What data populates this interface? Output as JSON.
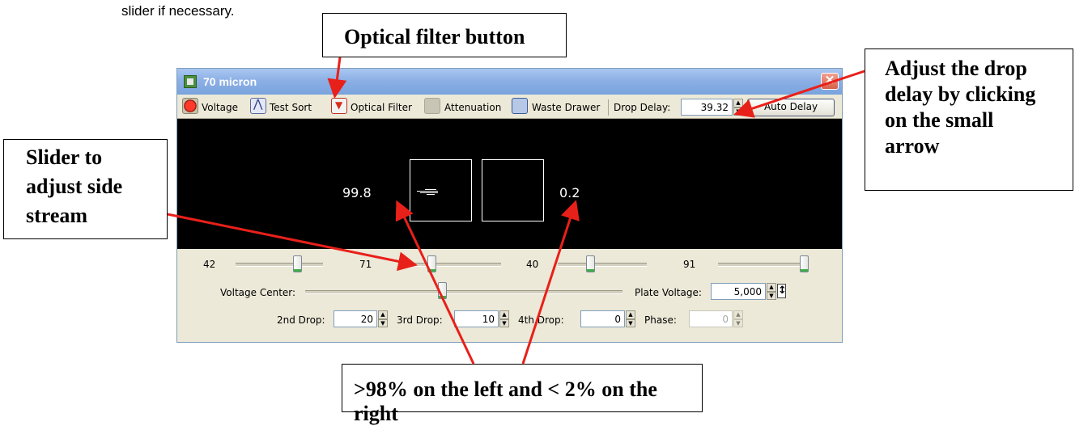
{
  "doc_text": "slider if necessary.",
  "callouts": {
    "optical_filter": "Optical filter button",
    "drop_delay": "Adjust the drop delay by clicking on the small arrow",
    "drop_delay_lines": [
      "Adjust the drop",
      "delay by clicking",
      "on the small",
      "arrow"
    ],
    "side_stream_lines": [
      "Slider to",
      "adjust side",
      "stream"
    ],
    "percent_note": ">98% on the left and < 2% on the right"
  },
  "window": {
    "title": "70 micron",
    "close_glyph": "✕"
  },
  "toolbar": {
    "voltage": "Voltage",
    "test_sort": "Test Sort",
    "optical_filter": "Optical Filter",
    "attenuation": "Attenuation",
    "waste_drawer": "Waste Drawer",
    "drop_delay_label": "Drop Delay:",
    "drop_delay_value": "39.32",
    "auto_delay": "Auto Delay"
  },
  "stream_view": {
    "left_percent": "99.8",
    "right_percent": "0.2"
  },
  "sliders": [
    {
      "value": "42",
      "level": 0.73
    },
    {
      "value": "71",
      "level": 0.3
    },
    {
      "value": "40",
      "level": 0.35
    },
    {
      "value": "91",
      "level": 1.0
    }
  ],
  "voltage_center": {
    "label": "Voltage Center:",
    "level": 0.43
  },
  "plate_voltage": {
    "label": "Plate Voltage:",
    "value": "5,000"
  },
  "drops": {
    "second_label": "2nd Drop:",
    "second_value": "20",
    "third_label": "3rd Drop:",
    "third_value": "10",
    "fourth_label": "4th Drop:",
    "fourth_value": "0",
    "phase_label": "Phase:",
    "phase_value": "0"
  },
  "colors": {
    "annotation_arrow": "#e8201a",
    "stream_background": "#000000",
    "panel": "#ece9d8",
    "titlebar": "#8cb0e6"
  },
  "icons": [
    "voltage-icon",
    "test-sort-icon",
    "optical-filter-icon",
    "attenuation-icon",
    "waste-drawer-icon"
  ]
}
